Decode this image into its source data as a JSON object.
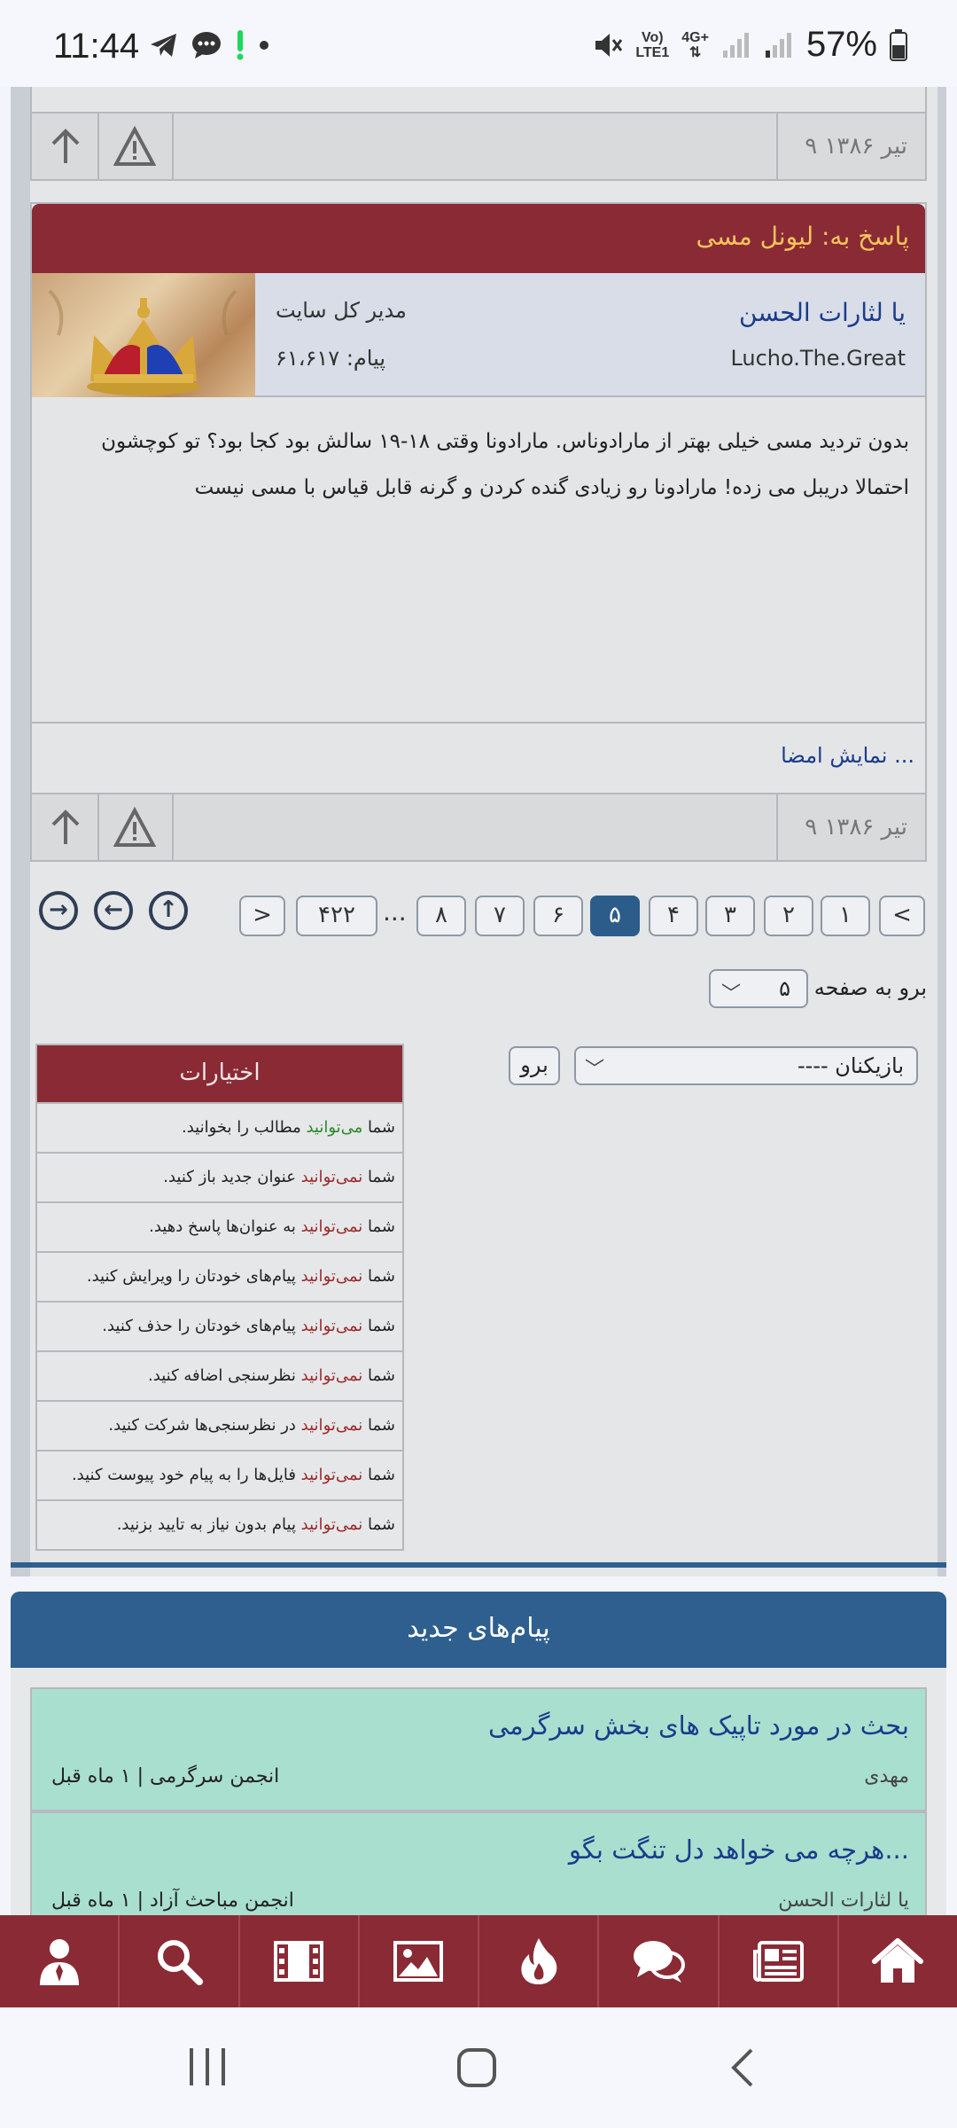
{
  "status_bar": {
    "time": "11:44",
    "network_top": "Vo)",
    "network_bottom": "LTE1",
    "data_label": "4G+",
    "battery": "57%"
  },
  "post_top_bar": {
    "date": "۹ تیر ۱۳۸۶"
  },
  "post": {
    "title": "پاسخ به: لیونل مسی",
    "author_name": "یا لثارات الحسن",
    "author_user": "Lucho.The.Great",
    "author_role": "مدیر کل سایت",
    "author_count": "پیام: ۶۱،۶۱۷",
    "body_line1": "بدون تردید مسی خیلی بهتر از مارادوناس. مارادونا وقتی ۱۸-۱۹ سالش بود کجا بود؟ تو کوچشون",
    "body_line2": "احتمالا دریبل می زده! مارادونا رو زیادی گنده کردن و گرنه قابل قیاس با مسی نیست",
    "show_signature": "نمایش امضا ...",
    "date": "۹ تیر ۱۳۸۶"
  },
  "pagination": {
    "prev": "<",
    "pages": [
      "۱",
      "۲",
      "۳",
      "۴",
      "۵",
      "۶",
      "۷",
      "۸"
    ],
    "active": "۵",
    "ellipsis": "...",
    "last": "۴۲۲",
    "next": ">"
  },
  "goto": {
    "label": "برو به صفحه",
    "value": "۵"
  },
  "forum_jump": {
    "value": "---- بازیکنان",
    "button": "برو"
  },
  "permissions": {
    "title": "اختیارات",
    "rows": [
      {
        "pre": "شما ",
        "key": "می‌توانید",
        "rest": " مطالب را بخوانید.",
        "type": "can"
      },
      {
        "pre": "شما ",
        "key": "نمی‌توانید",
        "rest": " عنوان جدید باز کنید.",
        "type": "cant"
      },
      {
        "pre": "شما ",
        "key": "نمی‌توانید",
        "rest": " به عنوان‌ها پاسخ دهید.",
        "type": "cant"
      },
      {
        "pre": "شما ",
        "key": "نمی‌توانید",
        "rest": " پیام‌های خودتان را ویرایش کنید.",
        "type": "cant"
      },
      {
        "pre": "شما ",
        "key": "نمی‌توانید",
        "rest": " پیام‌های خودتان را حذف کنید.",
        "type": "cant"
      },
      {
        "pre": "شما ",
        "key": "نمی‌توانید",
        "rest": " نظرسنجی اضافه کنید.",
        "type": "cant"
      },
      {
        "pre": "شما ",
        "key": "نمی‌توانید",
        "rest": " در نظرسنجی‌ها شرکت کنید.",
        "type": "cant"
      },
      {
        "pre": "شما ",
        "key": "نمی‌توانید",
        "rest": " فایل‌ها را به پیام خود پیوست کنید.",
        "type": "cant"
      },
      {
        "pre": "شما ",
        "key": "نمی‌توانید",
        "rest": " پیام بدون نیاز به تایید بزنید.",
        "type": "cant"
      }
    ]
  },
  "new_posts": {
    "title": "پیام‌های جدید",
    "items": [
      {
        "title": "بحث در مورد تاپیک های بخش سرگرمی",
        "author": "مهدی",
        "meta": "انجمن سرگرمی | ۱ ماه قبل"
      },
      {
        "title": "هرچه می خواهد دل تنگت بگو...",
        "author": "یا لثارات الحسن",
        "meta": "انجمن مباحث آزاد | ۱ ماه قبل"
      }
    ]
  },
  "bottom_nav": [
    "user-icon",
    "search-icon",
    "video-icon",
    "image-icon",
    "fire-icon",
    "chat-icon",
    "news-icon",
    "home-icon"
  ],
  "colors": {
    "header_red": "#8a2a35",
    "accent_blue": "#2e5f8e",
    "title_gold": "#f5c45c"
  }
}
